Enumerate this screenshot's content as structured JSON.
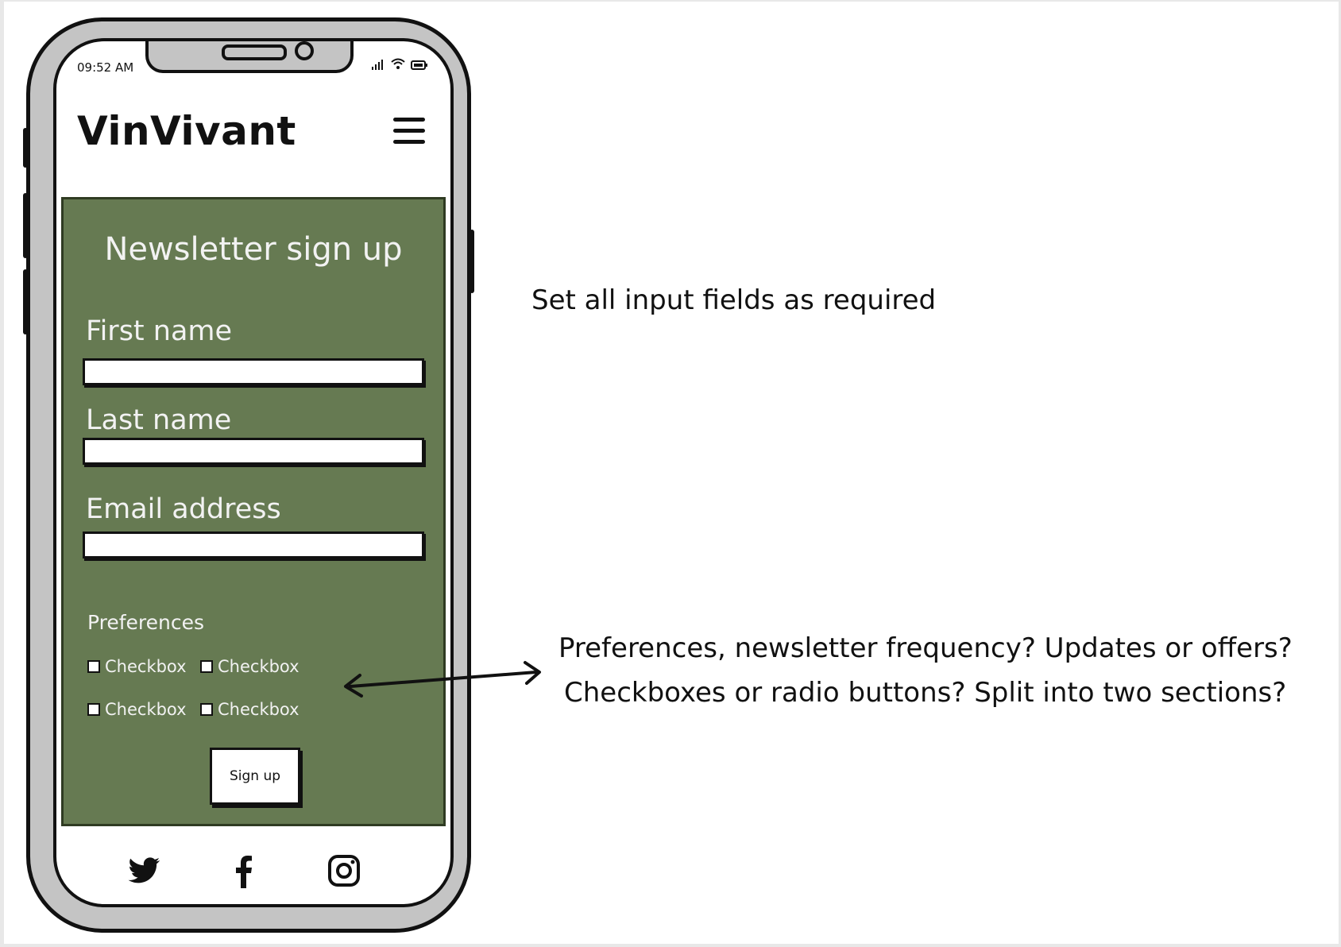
{
  "status_bar": {
    "time": "09:52 AM",
    "icons": [
      "signal-icon",
      "wifi-icon",
      "battery-icon"
    ]
  },
  "header": {
    "brand": "VinVivant",
    "menu_icon": "hamburger-menu-icon"
  },
  "form": {
    "title": "Newsletter sign up",
    "first_name_label": "First name",
    "last_name_label": "Last name",
    "email_label": "Email address",
    "first_name_value": "",
    "last_name_value": "",
    "email_value": "",
    "preferences_label": "Preferences",
    "checkboxes": [
      "Checkbox",
      "Checkbox",
      "Checkbox",
      "Checkbox"
    ],
    "submit_label": "Sign up",
    "panel_color": "#667a52"
  },
  "footer": {
    "social_icons": [
      "twitter-icon",
      "facebook-icon",
      "instagram-icon"
    ]
  },
  "annotations": {
    "required_note": "Set all input fields as required",
    "preferences_note_line1": "Preferences, newsletter frequency? Updates or offers?",
    "preferences_note_line2": "Checkboxes or radio buttons? Split into two sections?"
  }
}
